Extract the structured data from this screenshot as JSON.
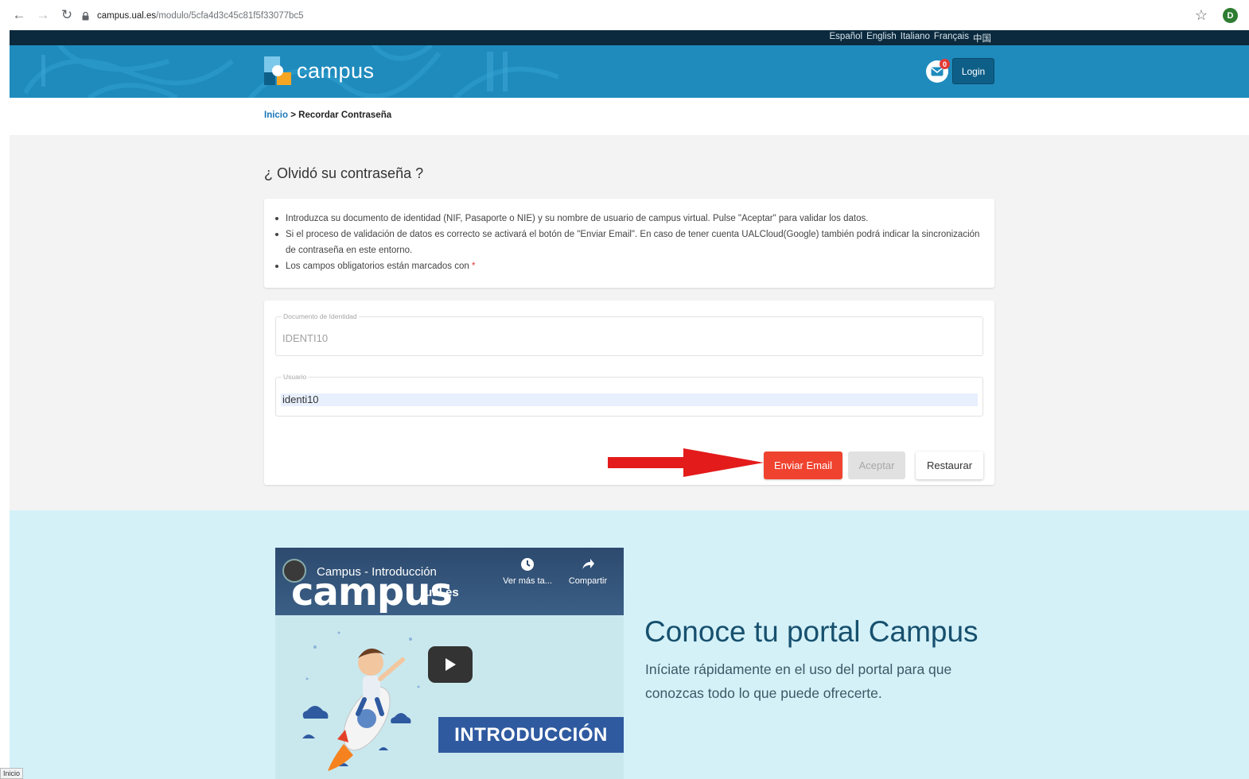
{
  "browser": {
    "url_host": "campus.ual.es",
    "url_path": "/modulo/5cfa4d3c45c81f5f33077bc5",
    "profile_initial": "D"
  },
  "header": {
    "languages": [
      "Español",
      "English",
      "Italiano",
      "Français",
      "中国"
    ],
    "logo_text": "campus",
    "notifications_count": "0",
    "login_label": "Login",
    "brand_color": "#1f8bbd"
  },
  "breadcrumb": {
    "home": "Inicio",
    "separator": ">",
    "current": "Recordar Contraseña"
  },
  "main": {
    "title": "¿ Olvidó su contraseña ?",
    "info": [
      "Introduzca su documento de identidad (NIF, Pasaporte o NIE) y su nombre de usuario de campus virtual. Pulse \"Aceptar\" para validar los datos.",
      "Si el proceso de validación de datos es correcto se activará el botón de \"Enviar Email\". En caso de tener cuenta UALCloud(Google) también podrá indicar la sincronización de contraseña en este entorno.",
      "Los campos obligatorios están marcados con"
    ],
    "required_mark": "*",
    "fields": {
      "document_label": "Documento de Identidad",
      "document_value": "IDENTI10",
      "user_label": "Usuario",
      "user_value": "identi10"
    },
    "buttons": {
      "send_email": "Enviar Email",
      "accept": "Aceptar",
      "reset": "Restaurar"
    },
    "arrow_color": "#e31b1b"
  },
  "promo": {
    "video_title": "Campus - Introducción",
    "video_bigtext": "campus",
    "video_bigtext_suffix": ".ual.es",
    "watch_later": "Ver más ta...",
    "share": "Compartir",
    "intro_banner": "INTRODUCCIÓN",
    "title": "Conoce tu portal Campus",
    "description": "Iníciate rápidamente en el uso del portal para que conozcas todo lo que puede ofrecerte."
  },
  "status_tooltip": "Inicio"
}
